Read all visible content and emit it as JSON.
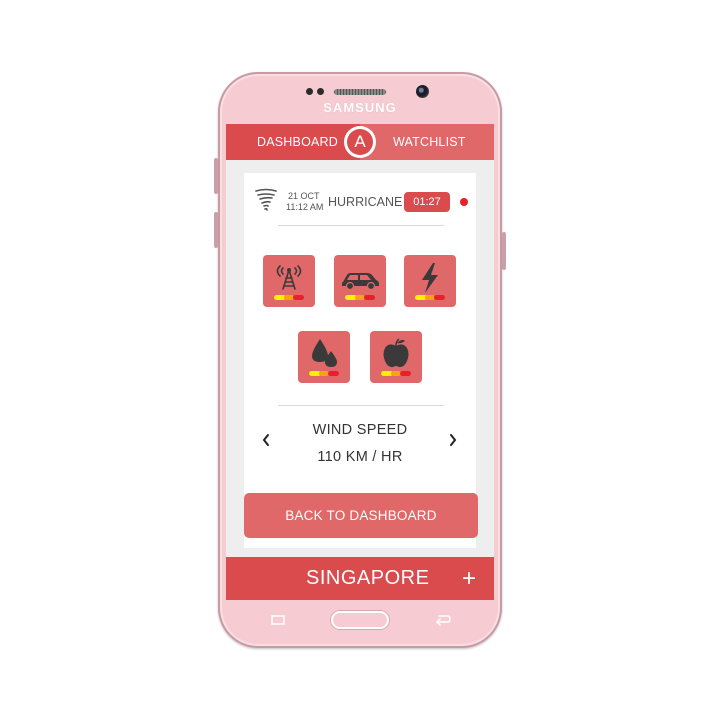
{
  "device": {
    "brand": "SAMSUNG"
  },
  "nav": {
    "dashboard_label": "DASHBOARD",
    "logo_letter": "A",
    "watchlist_label": "WATCHLIST"
  },
  "alert": {
    "date": "21 OCT",
    "time": "11:12 AM",
    "event": "HURRICANE",
    "countdown": "01:27",
    "event_icon": "tornado-icon",
    "live_indicator_color": "#e8202a"
  },
  "impact_icons": [
    {
      "name": "communication-tower-icon"
    },
    {
      "name": "car-icon"
    },
    {
      "name": "power-lightning-icon"
    },
    {
      "name": "water-drops-icon"
    },
    {
      "name": "apple-food-icon"
    }
  ],
  "metric": {
    "title": "WIND SPEED",
    "value": "110 KM / HR"
  },
  "actions": {
    "back_label": "BACK TO DASHBOARD"
  },
  "location": {
    "city": "SINGAPORE",
    "add_symbol": "+"
  },
  "colors": {
    "primary": "#d94b4d",
    "primary_light": "#e06869",
    "phone_body": "#f6ccd2",
    "light_yellow": "#ffef00",
    "light_orange": "#f7a21b",
    "light_red": "#e8202a"
  }
}
